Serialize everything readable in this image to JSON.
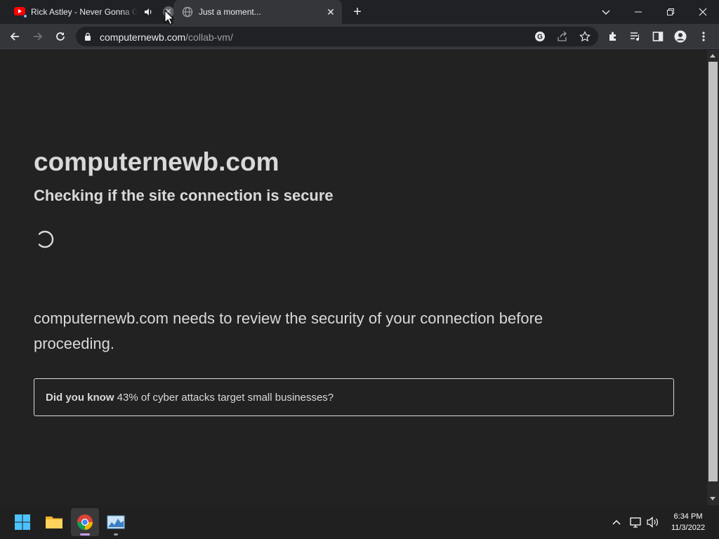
{
  "browser": {
    "tabs": [
      {
        "title": "Rick Astley - Never Gonna Give You Up",
        "close": "✕"
      },
      {
        "title": "Just a moment...",
        "close": "✕"
      }
    ],
    "new_tab": "+",
    "url": {
      "domain": "computernewb.com",
      "path": "/collab-vm/"
    }
  },
  "page": {
    "site_title": "computernewb.com",
    "subtitle": "Checking if the site connection is secure",
    "review_text": "computernewb.com needs to review the security of your connection before proceeding.",
    "did_you_know_label": "Did you know",
    "did_you_know_text": " 43% of cyber attacks target small businesses?"
  },
  "taskbar": {
    "time": "6:34 PM",
    "date": "11/3/2022"
  },
  "colors": {
    "page_bg": "#222222",
    "text": "#d9d9d9",
    "chrome_dark": "#202124",
    "chrome_toolbar": "#35363a"
  }
}
